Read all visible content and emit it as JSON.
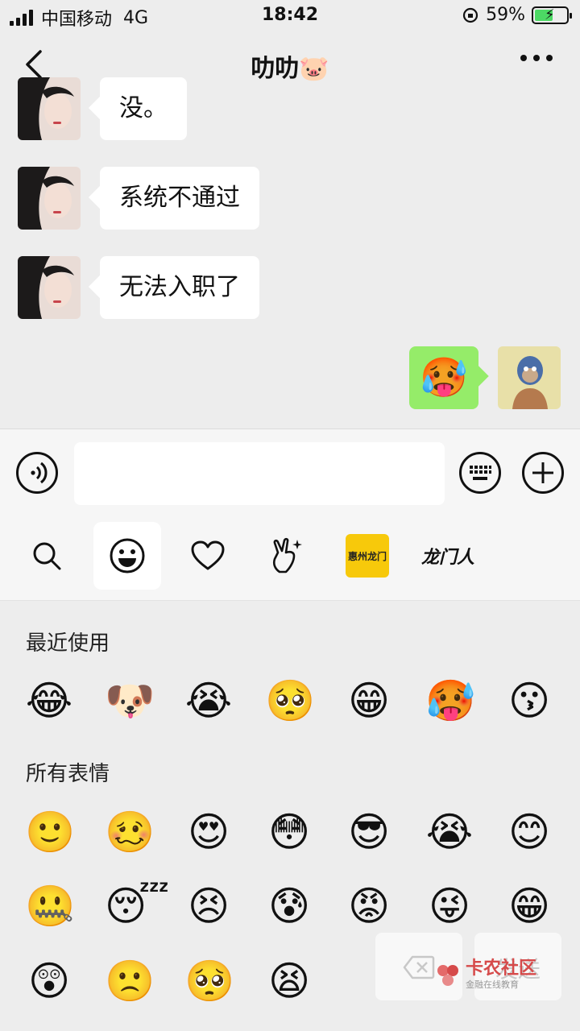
{
  "status_bar": {
    "carrier": "中国移动",
    "network": "4G",
    "time": "18:42",
    "battery": "59%",
    "battery_level": 0.59
  },
  "header": {
    "title": "叻叻🐷"
  },
  "messages": [
    {
      "side": "left",
      "text": "没。"
    },
    {
      "side": "left",
      "text": "系统不通过"
    },
    {
      "side": "left",
      "text": "无法入职了"
    },
    {
      "side": "right",
      "emoji": "🥵"
    }
  ],
  "emoji_tabs": [
    {
      "icon": "search-icon"
    },
    {
      "icon": "smile-icon",
      "active": true
    },
    {
      "icon": "heart-icon"
    },
    {
      "icon": "hand-icon"
    },
    {
      "label": "惠州龙门"
    },
    {
      "label": "龙门人"
    }
  ],
  "emoji_panel": {
    "recent_title": "最近使用",
    "recent": [
      "😂",
      "🐶",
      "😭",
      "🥺",
      "😁",
      "🥵",
      "😗"
    ],
    "all_title": "所有表情",
    "all": [
      "🙂",
      "🥴",
      "😍",
      "😳",
      "😎",
      "😭",
      "😊",
      "🤐",
      "😴",
      "😣",
      "😰",
      "😡",
      "😜",
      "😁",
      "😲",
      "🙁",
      "🥺",
      "😫"
    ]
  },
  "watermark": {
    "title": "卡农社区",
    "subtitle": "金融在线教育"
  },
  "send_label": "发送",
  "colors": {
    "background": "#ededed",
    "sent_bubble": "#95ec69",
    "sticker_tab": "#f7c90b"
  }
}
